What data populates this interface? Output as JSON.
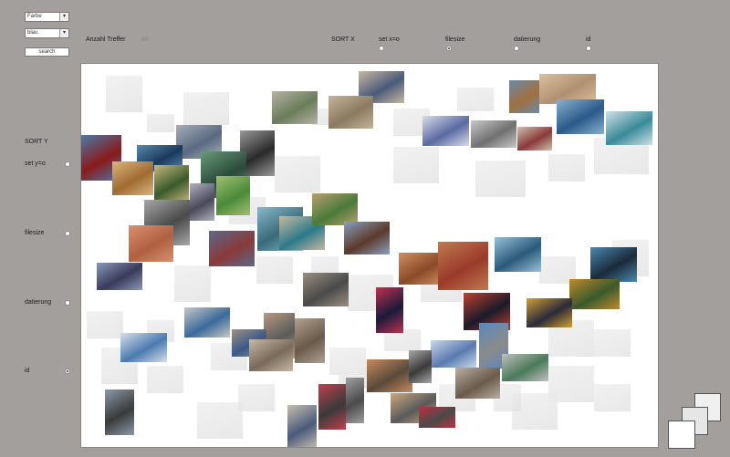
{
  "controls": {
    "color_mode_select": "Farbe",
    "color_value_select": "blau",
    "search_button": "search"
  },
  "header": {
    "result_count_label": "Anzahl Treffer",
    "result_count_value": "68"
  },
  "sort_x": {
    "title": "SORT X",
    "options": [
      {
        "label": "set x=o",
        "selected": false
      },
      {
        "label": "filesize",
        "selected": true
      },
      {
        "label": "datierung",
        "selected": false
      },
      {
        "label": "id",
        "selected": false
      }
    ]
  },
  "sort_y": {
    "title": "SORT Y",
    "options": [
      {
        "label": "set y=o",
        "selected": false
      },
      {
        "label": "filesize",
        "selected": false
      },
      {
        "label": "datierung",
        "selected": false
      },
      {
        "label": "id",
        "selected": true
      }
    ]
  }
}
